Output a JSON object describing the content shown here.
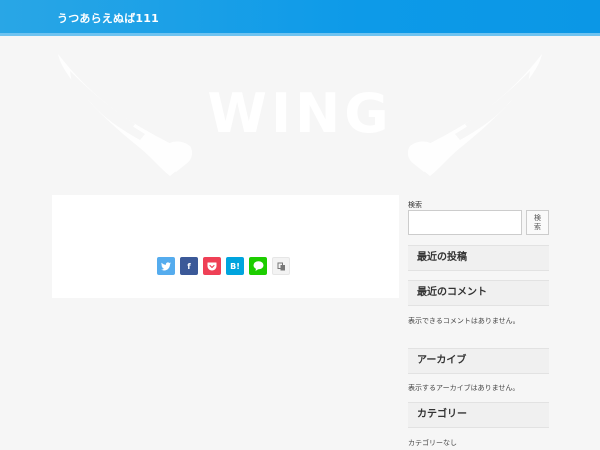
{
  "header": {
    "site_title": "うつあらえぬば111"
  },
  "hero": {
    "logo_text": "WING"
  },
  "share": {
    "buttons": [
      {
        "name": "twitter",
        "glyph": "🐦"
      },
      {
        "name": "facebook",
        "glyph": "f"
      },
      {
        "name": "pocket",
        "glyph": ""
      },
      {
        "name": "hatena",
        "glyph": "B!"
      },
      {
        "name": "line",
        "glyph": ""
      },
      {
        "name": "copy",
        "glyph": ""
      }
    ]
  },
  "sidebar": {
    "search": {
      "label": "検索",
      "button_label": "検索",
      "value": ""
    },
    "widgets": [
      {
        "title": "最近の投稿",
        "text": ""
      },
      {
        "title": "最近のコメント",
        "text": "表示できるコメントはありません。"
      },
      {
        "title": "アーカイブ",
        "text": "表示するアーカイブはありません。"
      },
      {
        "title": "カテゴリー",
        "text": "カテゴリーなし"
      }
    ]
  },
  "colors": {
    "header": "#0d9ae8",
    "twitter": "#55acee",
    "facebook": "#3b5998",
    "pocket": "#ef4056",
    "hatena": "#00a4de",
    "line": "#1dcd00"
  }
}
